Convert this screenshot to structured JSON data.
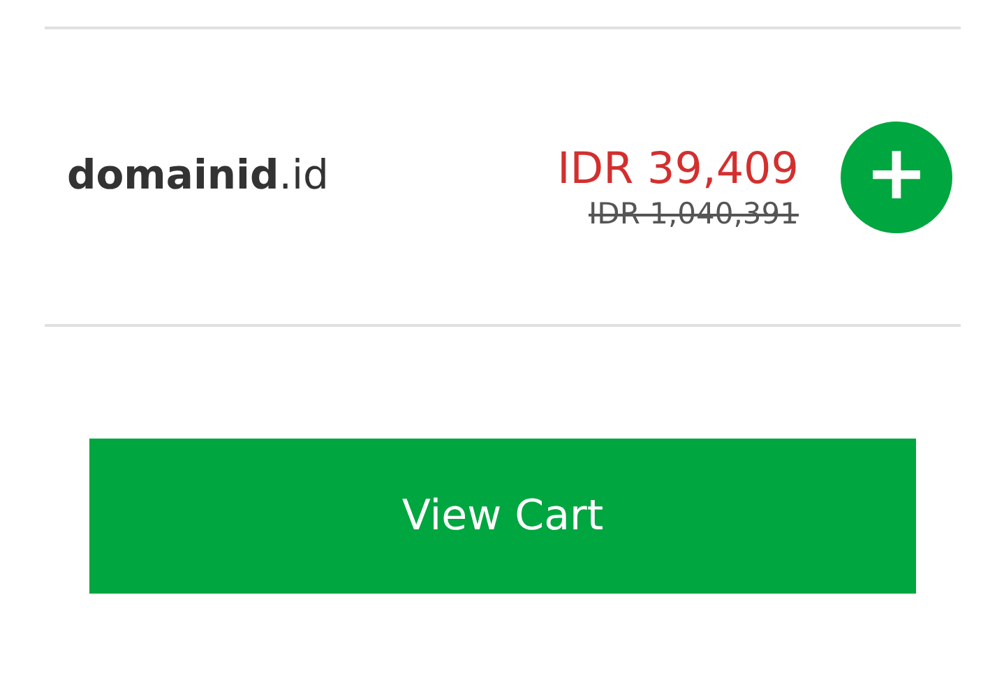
{
  "domain_item": {
    "name": "**domainid**.id",
    "price": "IDR 39,409",
    "original_price": "IDR 1,040,391"
  },
  "add_button": {
    "label": "+"
  },
  "cart_button": {
    "label": "View Cart"
  }
}
